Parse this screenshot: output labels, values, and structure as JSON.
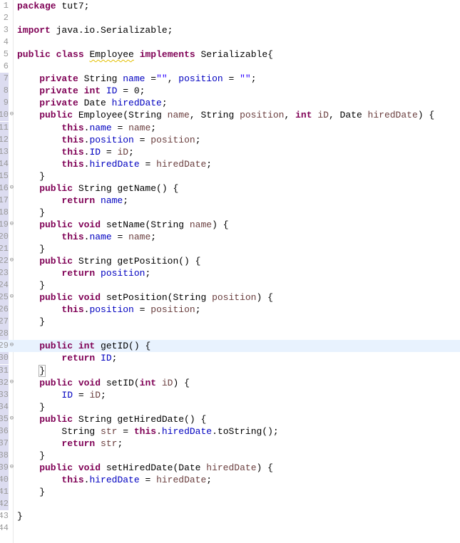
{
  "editor": {
    "language": "java",
    "current_line": 29,
    "lines": [
      {
        "n": "1",
        "tokens": [
          {
            "t": "package",
            "c": "kw"
          },
          {
            "t": " tut7;",
            "c": ""
          }
        ]
      },
      {
        "n": "2",
        "tokens": []
      },
      {
        "n": "3",
        "tokens": [
          {
            "t": "import",
            "c": "kw"
          },
          {
            "t": " java.io.Serializable;",
            "c": ""
          }
        ]
      },
      {
        "n": "4",
        "tokens": []
      },
      {
        "n": "5",
        "tokens": [
          {
            "t": "public",
            "c": "kw"
          },
          {
            "t": " ",
            "c": ""
          },
          {
            "t": "class",
            "c": "kw"
          },
          {
            "t": " ",
            "c": ""
          },
          {
            "t": "Employee",
            "c": "warn"
          },
          {
            "t": " ",
            "c": ""
          },
          {
            "t": "implements",
            "c": "kw"
          },
          {
            "t": " Serializable{",
            "c": ""
          }
        ]
      },
      {
        "n": "6",
        "tokens": []
      },
      {
        "n": "7",
        "tokens": [
          {
            "t": "    private",
            "c": "kw"
          },
          {
            "t": " String ",
            "c": ""
          },
          {
            "t": "name",
            "c": "fld"
          },
          {
            "t": " =",
            "c": ""
          },
          {
            "t": "\"\"",
            "c": "str"
          },
          {
            "t": ", ",
            "c": ""
          },
          {
            "t": "position",
            "c": "fld"
          },
          {
            "t": " = ",
            "c": ""
          },
          {
            "t": "\"\"",
            "c": "str"
          },
          {
            "t": ";",
            "c": ""
          }
        ]
      },
      {
        "n": "8",
        "tokens": [
          {
            "t": "    private",
            "c": "kw"
          },
          {
            "t": " ",
            "c": ""
          },
          {
            "t": "int",
            "c": "kw"
          },
          {
            "t": " ",
            "c": ""
          },
          {
            "t": "ID",
            "c": "fld"
          },
          {
            "t": " = 0;",
            "c": ""
          }
        ]
      },
      {
        "n": "9",
        "tokens": [
          {
            "t": "    private",
            "c": "kw"
          },
          {
            "t": " Date ",
            "c": ""
          },
          {
            "t": "hiredDate",
            "c": "fld"
          },
          {
            "t": ";",
            "c": ""
          }
        ]
      },
      {
        "n": "10",
        "fold": true,
        "tokens": [
          {
            "t": "    public",
            "c": "kw"
          },
          {
            "t": " Employee(String ",
            "c": ""
          },
          {
            "t": "name",
            "c": "par"
          },
          {
            "t": ", String ",
            "c": ""
          },
          {
            "t": "position",
            "c": "par"
          },
          {
            "t": ", ",
            "c": ""
          },
          {
            "t": "int",
            "c": "kw"
          },
          {
            "t": " ",
            "c": ""
          },
          {
            "t": "iD",
            "c": "par"
          },
          {
            "t": ", Date ",
            "c": ""
          },
          {
            "t": "hiredDate",
            "c": "par"
          },
          {
            "t": ") {",
            "c": ""
          }
        ]
      },
      {
        "n": "11",
        "tokens": [
          {
            "t": "        this",
            "c": "kw"
          },
          {
            "t": ".",
            "c": ""
          },
          {
            "t": "name",
            "c": "fld"
          },
          {
            "t": " = ",
            "c": ""
          },
          {
            "t": "name",
            "c": "par"
          },
          {
            "t": ";",
            "c": ""
          }
        ]
      },
      {
        "n": "12",
        "tokens": [
          {
            "t": "        this",
            "c": "kw"
          },
          {
            "t": ".",
            "c": ""
          },
          {
            "t": "position",
            "c": "fld"
          },
          {
            "t": " = ",
            "c": ""
          },
          {
            "t": "position",
            "c": "par"
          },
          {
            "t": ";",
            "c": ""
          }
        ]
      },
      {
        "n": "13",
        "tokens": [
          {
            "t": "        this",
            "c": "kw"
          },
          {
            "t": ".",
            "c": ""
          },
          {
            "t": "ID",
            "c": "fld"
          },
          {
            "t": " = ",
            "c": ""
          },
          {
            "t": "iD",
            "c": "par"
          },
          {
            "t": ";",
            "c": ""
          }
        ]
      },
      {
        "n": "14",
        "tokens": [
          {
            "t": "        this",
            "c": "kw"
          },
          {
            "t": ".",
            "c": ""
          },
          {
            "t": "hiredDate",
            "c": "fld"
          },
          {
            "t": " = ",
            "c": ""
          },
          {
            "t": "hiredDate",
            "c": "par"
          },
          {
            "t": ";",
            "c": ""
          }
        ]
      },
      {
        "n": "15",
        "tokens": [
          {
            "t": "    }",
            "c": ""
          }
        ]
      },
      {
        "n": "16",
        "fold": true,
        "tokens": [
          {
            "t": "    public",
            "c": "kw"
          },
          {
            "t": " String getName() {",
            "c": ""
          }
        ]
      },
      {
        "n": "17",
        "tokens": [
          {
            "t": "        return",
            "c": "kw"
          },
          {
            "t": " ",
            "c": ""
          },
          {
            "t": "name",
            "c": "fld"
          },
          {
            "t": ";",
            "c": ""
          }
        ]
      },
      {
        "n": "18",
        "tokens": [
          {
            "t": "    }",
            "c": ""
          }
        ]
      },
      {
        "n": "19",
        "fold": true,
        "tokens": [
          {
            "t": "    public",
            "c": "kw"
          },
          {
            "t": " ",
            "c": ""
          },
          {
            "t": "void",
            "c": "kw"
          },
          {
            "t": " setName(String ",
            "c": ""
          },
          {
            "t": "name",
            "c": "par"
          },
          {
            "t": ") {",
            "c": ""
          }
        ]
      },
      {
        "n": "20",
        "tokens": [
          {
            "t": "        this",
            "c": "kw"
          },
          {
            "t": ".",
            "c": ""
          },
          {
            "t": "name",
            "c": "fld"
          },
          {
            "t": " = ",
            "c": ""
          },
          {
            "t": "name",
            "c": "par"
          },
          {
            "t": ";",
            "c": ""
          }
        ]
      },
      {
        "n": "21",
        "tokens": [
          {
            "t": "    }",
            "c": ""
          }
        ]
      },
      {
        "n": "22",
        "fold": true,
        "tokens": [
          {
            "t": "    public",
            "c": "kw"
          },
          {
            "t": " String getPosition() {",
            "c": ""
          }
        ]
      },
      {
        "n": "23",
        "tokens": [
          {
            "t": "        return",
            "c": "kw"
          },
          {
            "t": " ",
            "c": ""
          },
          {
            "t": "position",
            "c": "fld"
          },
          {
            "t": ";",
            "c": ""
          }
        ]
      },
      {
        "n": "24",
        "tokens": [
          {
            "t": "    }",
            "c": ""
          }
        ]
      },
      {
        "n": "25",
        "fold": true,
        "tokens": [
          {
            "t": "    public",
            "c": "kw"
          },
          {
            "t": " ",
            "c": ""
          },
          {
            "t": "void",
            "c": "kw"
          },
          {
            "t": " setPosition(String ",
            "c": ""
          },
          {
            "t": "position",
            "c": "par"
          },
          {
            "t": ") {",
            "c": ""
          }
        ]
      },
      {
        "n": "26",
        "tokens": [
          {
            "t": "        this",
            "c": "kw"
          },
          {
            "t": ".",
            "c": ""
          },
          {
            "t": "position",
            "c": "fld"
          },
          {
            "t": " = ",
            "c": ""
          },
          {
            "t": "position",
            "c": "par"
          },
          {
            "t": ";",
            "c": ""
          }
        ]
      },
      {
        "n": "27",
        "tokens": [
          {
            "t": "    }",
            "c": ""
          }
        ]
      },
      {
        "n": "28",
        "tokens": []
      },
      {
        "n": "29",
        "fold": true,
        "tokens": [
          {
            "t": "    public",
            "c": "kw"
          },
          {
            "t": " ",
            "c": ""
          },
          {
            "t": "int",
            "c": "kw"
          },
          {
            "t": " getID() {",
            "c": ""
          }
        ]
      },
      {
        "n": "30",
        "tokens": [
          {
            "t": "        return",
            "c": "kw"
          },
          {
            "t": " ",
            "c": ""
          },
          {
            "t": "ID",
            "c": "fld"
          },
          {
            "t": ";",
            "c": ""
          }
        ]
      },
      {
        "n": "31",
        "tokens": [
          {
            "t": "    ",
            "c": ""
          },
          {
            "t": "}",
            "c": "bracket-box"
          }
        ]
      },
      {
        "n": "32",
        "fold": true,
        "tokens": [
          {
            "t": "    public",
            "c": "kw"
          },
          {
            "t": " ",
            "c": ""
          },
          {
            "t": "void",
            "c": "kw"
          },
          {
            "t": " setID(",
            "c": ""
          },
          {
            "t": "int",
            "c": "kw"
          },
          {
            "t": " ",
            "c": ""
          },
          {
            "t": "iD",
            "c": "par"
          },
          {
            "t": ") {",
            "c": ""
          }
        ]
      },
      {
        "n": "33",
        "tokens": [
          {
            "t": "        ",
            "c": ""
          },
          {
            "t": "ID",
            "c": "fld"
          },
          {
            "t": " = ",
            "c": ""
          },
          {
            "t": "iD",
            "c": "par"
          },
          {
            "t": ";",
            "c": ""
          }
        ]
      },
      {
        "n": "34",
        "tokens": [
          {
            "t": "    }",
            "c": ""
          }
        ]
      },
      {
        "n": "35",
        "fold": true,
        "tokens": [
          {
            "t": "    public",
            "c": "kw"
          },
          {
            "t": " String getHiredDate() {",
            "c": ""
          }
        ]
      },
      {
        "n": "36",
        "tokens": [
          {
            "t": "        String ",
            "c": ""
          },
          {
            "t": "str",
            "c": "par"
          },
          {
            "t": " = ",
            "c": ""
          },
          {
            "t": "this",
            "c": "kw"
          },
          {
            "t": ".",
            "c": ""
          },
          {
            "t": "hiredDate",
            "c": "fld"
          },
          {
            "t": ".toString();",
            "c": ""
          }
        ]
      },
      {
        "n": "37",
        "tokens": [
          {
            "t": "        return",
            "c": "kw"
          },
          {
            "t": " ",
            "c": ""
          },
          {
            "t": "str",
            "c": "par"
          },
          {
            "t": ";",
            "c": ""
          }
        ]
      },
      {
        "n": "38",
        "tokens": [
          {
            "t": "    }",
            "c": ""
          }
        ]
      },
      {
        "n": "39",
        "fold": true,
        "tokens": [
          {
            "t": "    public",
            "c": "kw"
          },
          {
            "t": " ",
            "c": ""
          },
          {
            "t": "void",
            "c": "kw"
          },
          {
            "t": " setHiredDate(Date ",
            "c": ""
          },
          {
            "t": "hiredDate",
            "c": "par"
          },
          {
            "t": ") {",
            "c": ""
          }
        ]
      },
      {
        "n": "40",
        "tokens": [
          {
            "t": "        this",
            "c": "kw"
          },
          {
            "t": ".",
            "c": ""
          },
          {
            "t": "hiredDate",
            "c": "fld"
          },
          {
            "t": " = ",
            "c": ""
          },
          {
            "t": "hiredDate",
            "c": "par"
          },
          {
            "t": ";",
            "c": ""
          }
        ]
      },
      {
        "n": "41",
        "tokens": [
          {
            "t": "    }",
            "c": ""
          }
        ]
      },
      {
        "n": "42",
        "tokens": []
      },
      {
        "n": "43",
        "tokens": [
          {
            "t": "}",
            "c": ""
          }
        ]
      },
      {
        "n": "44",
        "tokens": []
      }
    ],
    "colors": {
      "keyword": "#7f0055",
      "field": "#0000c0",
      "string": "#2a00ff",
      "parameter": "#6a3e3e",
      "current_line": "#e8f2fe"
    }
  }
}
